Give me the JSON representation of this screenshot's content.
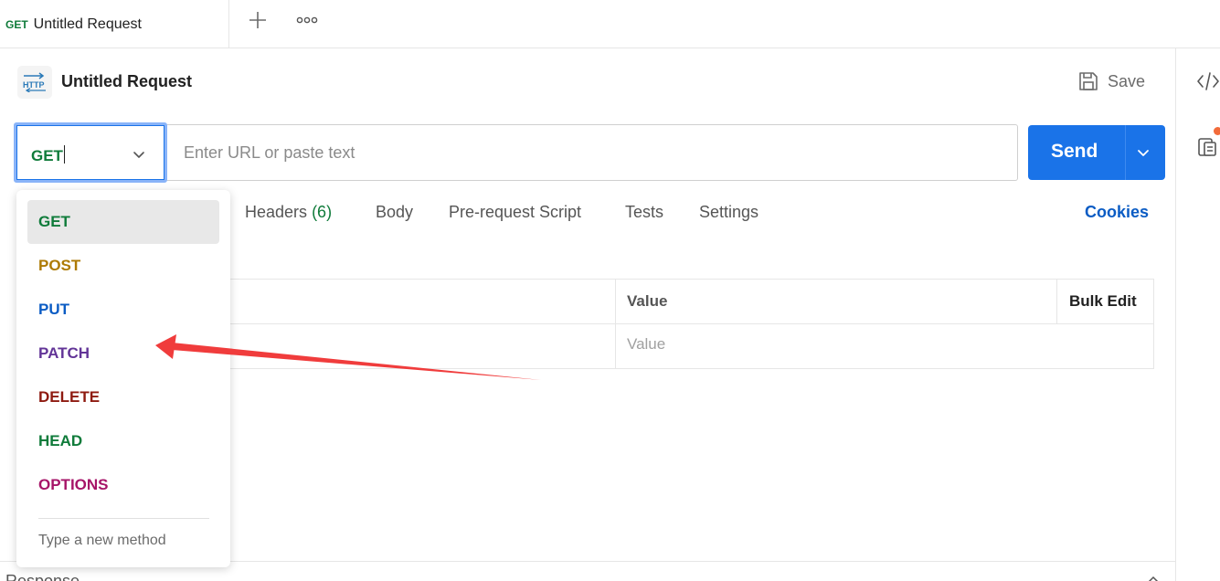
{
  "tabbar": {
    "active_tab": {
      "method": "GET",
      "title": "Untitled Request"
    }
  },
  "header": {
    "title": "Untitled Request",
    "save_label": "Save"
  },
  "url_bar": {
    "method": "GET",
    "url_placeholder": "Enter URL or paste text",
    "send_label": "Send"
  },
  "request_tabs": {
    "headers_label": "Headers",
    "headers_count": "(6)",
    "body": "Body",
    "pre_request": "Pre-request Script",
    "tests": "Tests",
    "settings": "Settings",
    "cookies": "Cookies"
  },
  "params_table": {
    "value_header": "Value",
    "bulk_edit": "Bulk Edit",
    "value_placeholder": "Value"
  },
  "method_dropdown": {
    "items": [
      {
        "label": "GET",
        "color": "#0f7b3a"
      },
      {
        "label": "POST",
        "color": "#ad7a03"
      },
      {
        "label": "PUT",
        "color": "#0b5cc4"
      },
      {
        "label": "PATCH",
        "color": "#623497"
      },
      {
        "label": "DELETE",
        "color": "#8e1a10"
      },
      {
        "label": "HEAD",
        "color": "#0f7b3a"
      },
      {
        "label": "OPTIONS",
        "color": "#a61468"
      }
    ],
    "selected": "GET",
    "new_method": "Type a new method"
  },
  "response": {
    "label": "Response"
  },
  "colors": {
    "accent": "#1a73e8",
    "annotation_arrow": "#f03c3c"
  }
}
